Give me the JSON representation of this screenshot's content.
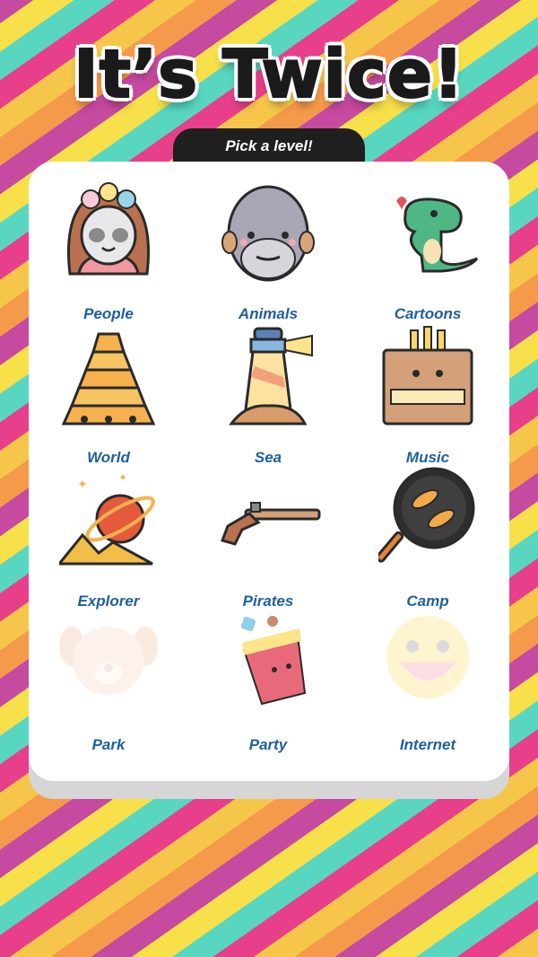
{
  "title": "It’s Twice!",
  "subtitle": "Pick a level!",
  "levels": [
    {
      "label": "People",
      "icon": "woman-avatar-icon",
      "locked": false
    },
    {
      "label": "Animals",
      "icon": "walrus-icon",
      "locked": false
    },
    {
      "label": "Cartoons",
      "icon": "dinosaur-icon",
      "locked": false
    },
    {
      "label": "World",
      "icon": "tower-of-babel-icon",
      "locked": false
    },
    {
      "label": "Sea",
      "icon": "lighthouse-icon",
      "locked": false
    },
    {
      "label": "Music",
      "icon": "pipe-organ-icon",
      "locked": false
    },
    {
      "label": "Explorer",
      "icon": "planet-desert-icon",
      "locked": false
    },
    {
      "label": "Pirates",
      "icon": "flintlock-pistol-icon",
      "locked": false
    },
    {
      "label": "Camp",
      "icon": "frying-pan-fish-icon",
      "locked": false
    },
    {
      "label": "Park",
      "icon": "dog-face-icon",
      "locked": true
    },
    {
      "label": "Party",
      "icon": "party-cup-icon",
      "locked": false
    },
    {
      "label": "Internet",
      "icon": "laughing-emoji-icon",
      "locked": true
    }
  ]
}
